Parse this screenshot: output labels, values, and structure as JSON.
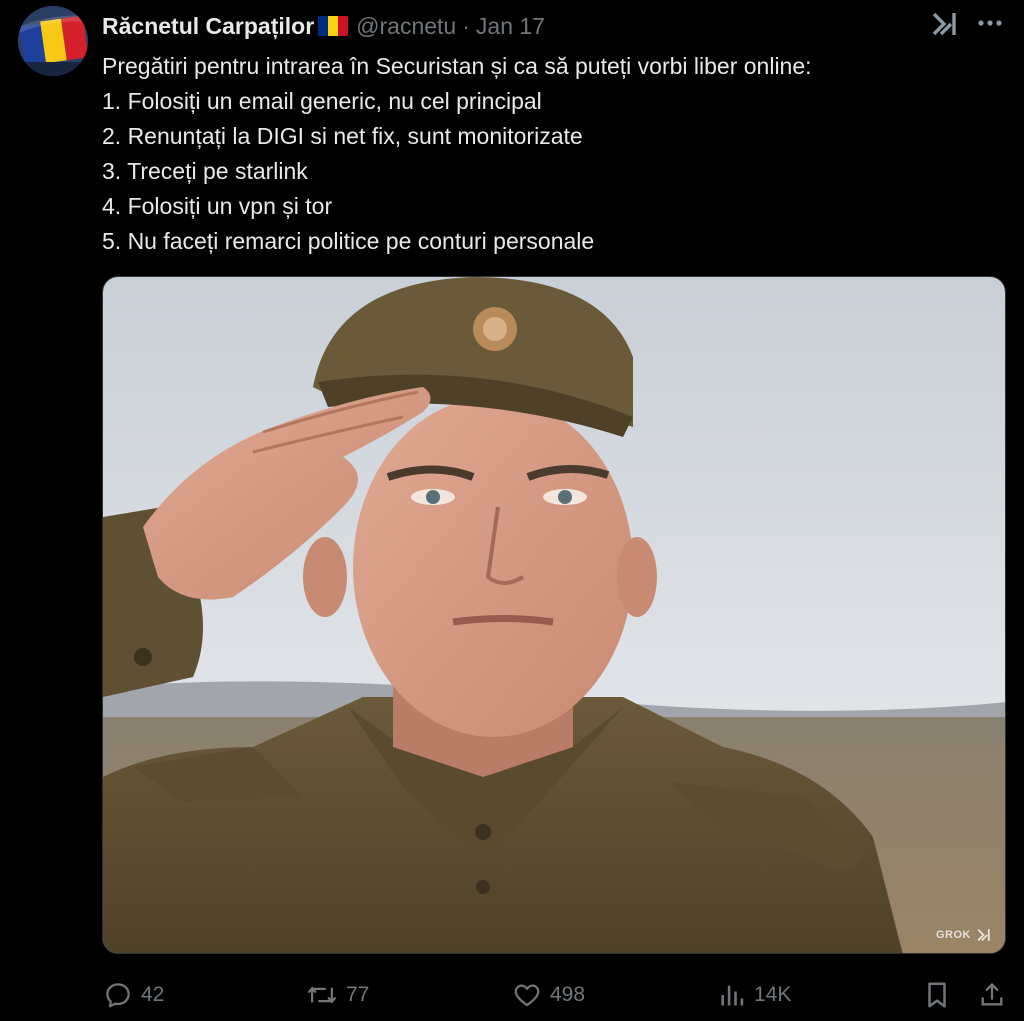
{
  "author": {
    "display_name": "Răcnetul Carpaților",
    "handle": "@racnetu",
    "separator": "·",
    "date": "Jan 17",
    "flag_colors": [
      "#002B7F",
      "#FCD116",
      "#CE1126"
    ]
  },
  "header_icons": {
    "grok": "grok-icon",
    "more": "more-icon"
  },
  "tweet": {
    "lines": [
      "Pregătiri pentru intrarea în Securistan și ca să puteți vorbi liber online:",
      "1. Folosiți un email generic, nu cel principal",
      "2. Renunțați la DIGI si net fix, sunt monitorizate",
      "3. Treceți pe starlink",
      "4. Folosiți un vpn și tor",
      "5. Nu faceți remarci politice pe conturi personale"
    ]
  },
  "media": {
    "watermark": "GROK"
  },
  "actions": {
    "replies": "42",
    "reposts": "77",
    "likes": "498",
    "views": "14K"
  },
  "colors": {
    "background": "#000000",
    "text": "#e7e9ea",
    "muted": "#71767b"
  }
}
